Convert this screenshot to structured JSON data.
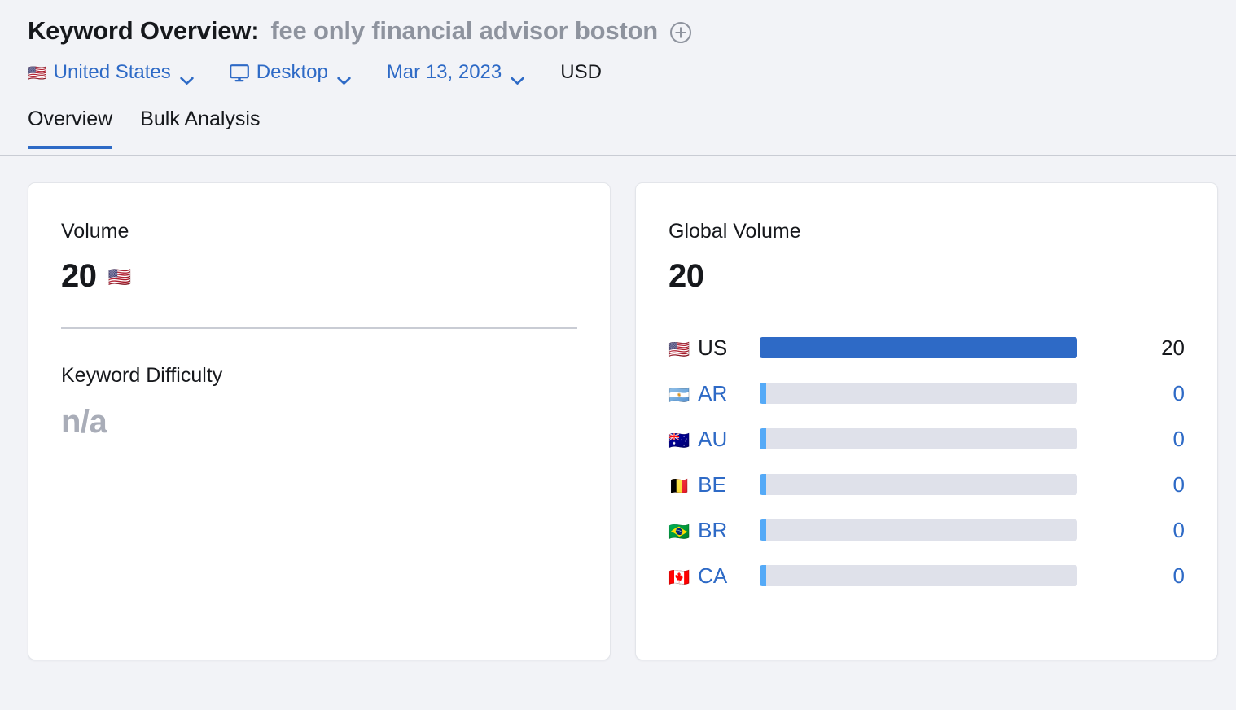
{
  "header": {
    "title_prefix": "Keyword Overview:",
    "keyword": "fee only financial advisor boston",
    "add_icon": "plus-circle-icon",
    "filters": {
      "country": {
        "flag": "🇺🇸",
        "label": "United States"
      },
      "device": {
        "icon": "monitor-icon",
        "label": "Desktop"
      },
      "date": {
        "label": "Mar 13, 2023"
      },
      "currency": {
        "label": "USD"
      }
    }
  },
  "tabs": [
    {
      "label": "Overview",
      "active": true
    },
    {
      "label": "Bulk Analysis",
      "active": false
    }
  ],
  "volume_card": {
    "label": "Volume",
    "value": "20",
    "flag": "🇺🇸",
    "difficulty_label": "Keyword Difficulty",
    "difficulty_value": "n/a"
  },
  "global_card": {
    "label": "Global Volume",
    "value": "20"
  },
  "chart_data": {
    "type": "bar",
    "title": "Global Volume",
    "orientation": "horizontal",
    "xlabel": "",
    "ylabel": "",
    "grid": false,
    "legend": "none",
    "total": 20,
    "xlim": [
      0,
      20
    ],
    "categories": [
      "US",
      "AR",
      "AU",
      "BE",
      "BR",
      "CA"
    ],
    "values": [
      20,
      0,
      0,
      0,
      0,
      0
    ],
    "flags": [
      "🇺🇸",
      "🇦🇷",
      "🇦🇺",
      "🇧🇪",
      "🇧🇷",
      "🇨🇦"
    ],
    "value_labels": [
      "20",
      "0",
      "0",
      "0",
      "0",
      "0"
    ],
    "colors": {
      "bar_fill": "#2e6ac6",
      "bar_stub": "#55aaf7",
      "bar_track": "#dfe1ea",
      "link": "#2e6ac6",
      "text": "#16181c"
    }
  },
  "theme": {
    "page_background": "#f2f3f7",
    "card_background": "#ffffff",
    "accent": "#2e6ac6",
    "muted": "#8e939e",
    "divider": "#c9ccd4"
  }
}
